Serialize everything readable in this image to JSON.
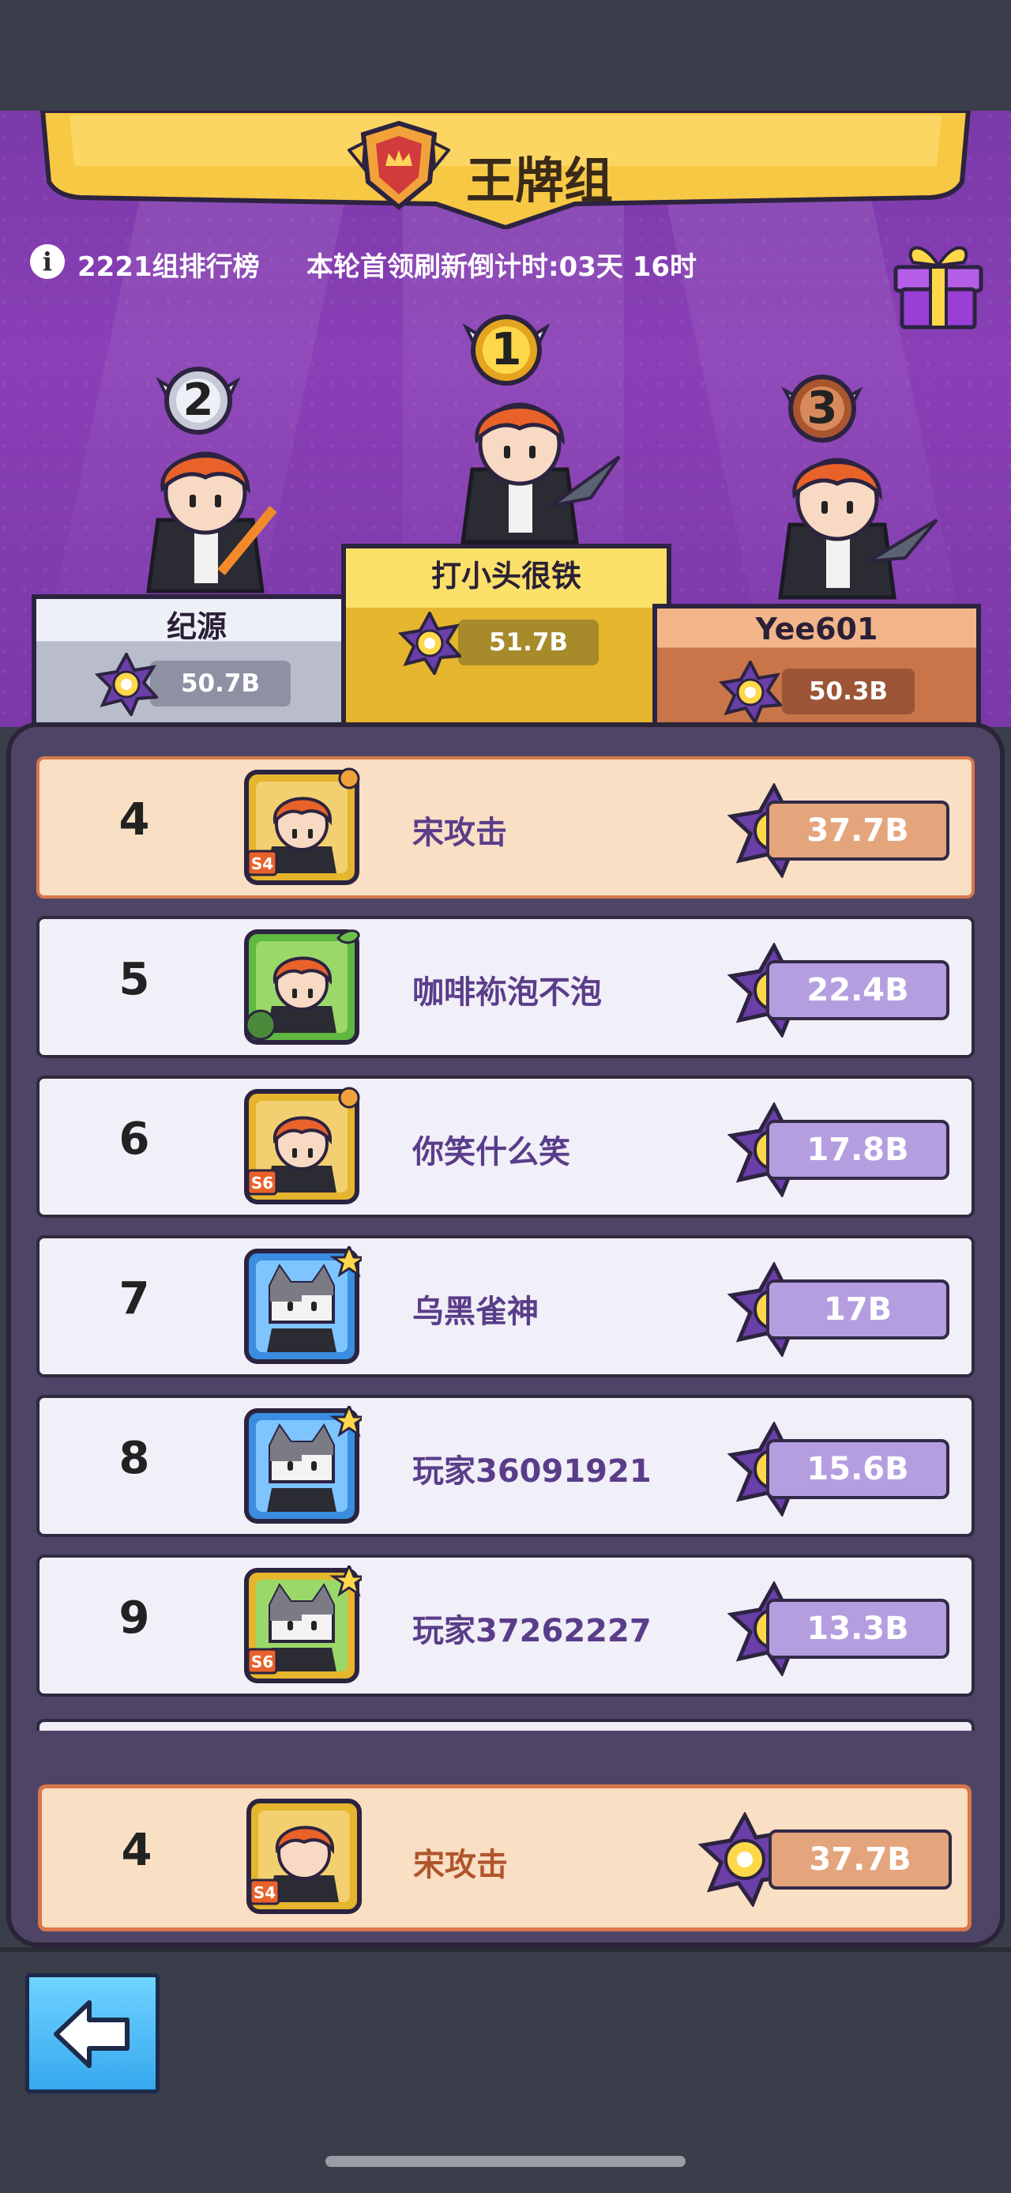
{
  "header": {
    "title": "王牌组",
    "board": "2221组排行榜",
    "countdown": "本轮首领刷新倒计时:03天 16时"
  },
  "podium": [
    {
      "rank": "2",
      "name": "纪源",
      "score": "50.7B"
    },
    {
      "rank": "1",
      "name": "打小头很铁",
      "score": "51.7B"
    },
    {
      "rank": "3",
      "name": "Yee601",
      "score": "50.3B"
    }
  ],
  "rows": [
    {
      "rank": "4",
      "name": "宋攻击",
      "score": "37.7B",
      "avatar": "redhair-gold",
      "season": "S4",
      "self": true
    },
    {
      "rank": "5",
      "name": "咖啡袮泡不泡",
      "score": "22.4B",
      "avatar": "redhair-green",
      "season": "",
      "self": false
    },
    {
      "rank": "6",
      "name": "你笑什么笑",
      "score": "17.8B",
      "avatar": "redhair-gold",
      "season": "S6",
      "self": false
    },
    {
      "rank": "7",
      "name": "乌黑雀神",
      "score": "17B",
      "avatar": "cat-blue",
      "season": "",
      "self": false
    },
    {
      "rank": "8",
      "name": "玩家36091921",
      "score": "15.6B",
      "avatar": "cat-blue",
      "season": "",
      "self": false
    },
    {
      "rank": "9",
      "name": "玩家37262227",
      "score": "13.3B",
      "avatar": "cat-green",
      "season": "S6",
      "self": false
    }
  ],
  "mine": {
    "rank": "4",
    "name": "宋攻击",
    "score": "37.7B",
    "season": "S4"
  },
  "colors": {
    "stage": "#8a3fb6",
    "gold": "#f7c843",
    "silver": "#d9dbe6",
    "bronze": "#d98a5c",
    "accent_purple": "#5a3d8a"
  },
  "icons": {
    "back": "arrow-left-icon",
    "gift": "gift-icon",
    "info": "info-icon",
    "score_badge": "purple-star-badge-icon"
  }
}
